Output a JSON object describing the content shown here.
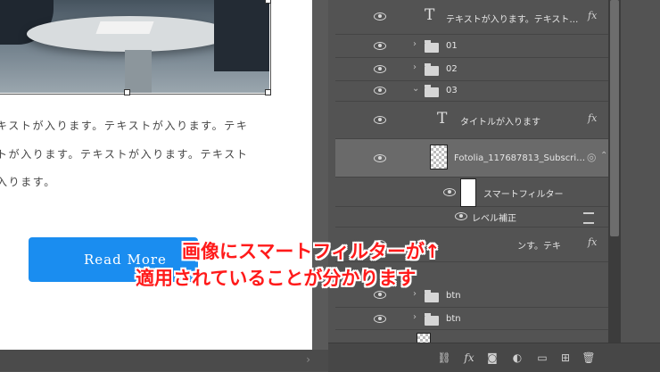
{
  "canvas": {
    "text_lines": [
      "キストが入ります。テキストが入ります。テキ",
      "トが入ります。テキストが入ります。テキスト",
      "入ります。"
    ],
    "button_label": "Read More"
  },
  "layers": [
    {
      "kind": "text",
      "name": "テキストが入ります。テキスト…",
      "fx": "fx"
    },
    {
      "kind": "folder",
      "name": "01"
    },
    {
      "kind": "folder",
      "name": "02"
    },
    {
      "kind": "folder-open",
      "name": "03"
    },
    {
      "kind": "text",
      "name": "タイトルが入ります",
      "fx": "fx"
    },
    {
      "kind": "smart-object",
      "name": "Fotolia_117687813_Subscri…"
    },
    {
      "kind": "filter-group",
      "name": "スマートフィルター"
    },
    {
      "kind": "filter",
      "name": "レベル補正"
    },
    {
      "kind": "text",
      "name": "ンす。テキ",
      "fx": "fx"
    },
    {
      "kind": "folder",
      "name": "btn"
    },
    {
      "kind": "folder",
      "name": "btn"
    },
    {
      "kind": "image",
      "name": ""
    }
  ],
  "footer_icons": [
    "link-icon",
    "fx-icon",
    "mask-icon",
    "adjustment-icon",
    "group-icon",
    "new-layer-icon",
    "trash-icon"
  ],
  "annotation": {
    "line1": "画像にスマートフィルターが↑",
    "line2": "適用されていることが分かります",
    "color": "#ff1a1a"
  }
}
